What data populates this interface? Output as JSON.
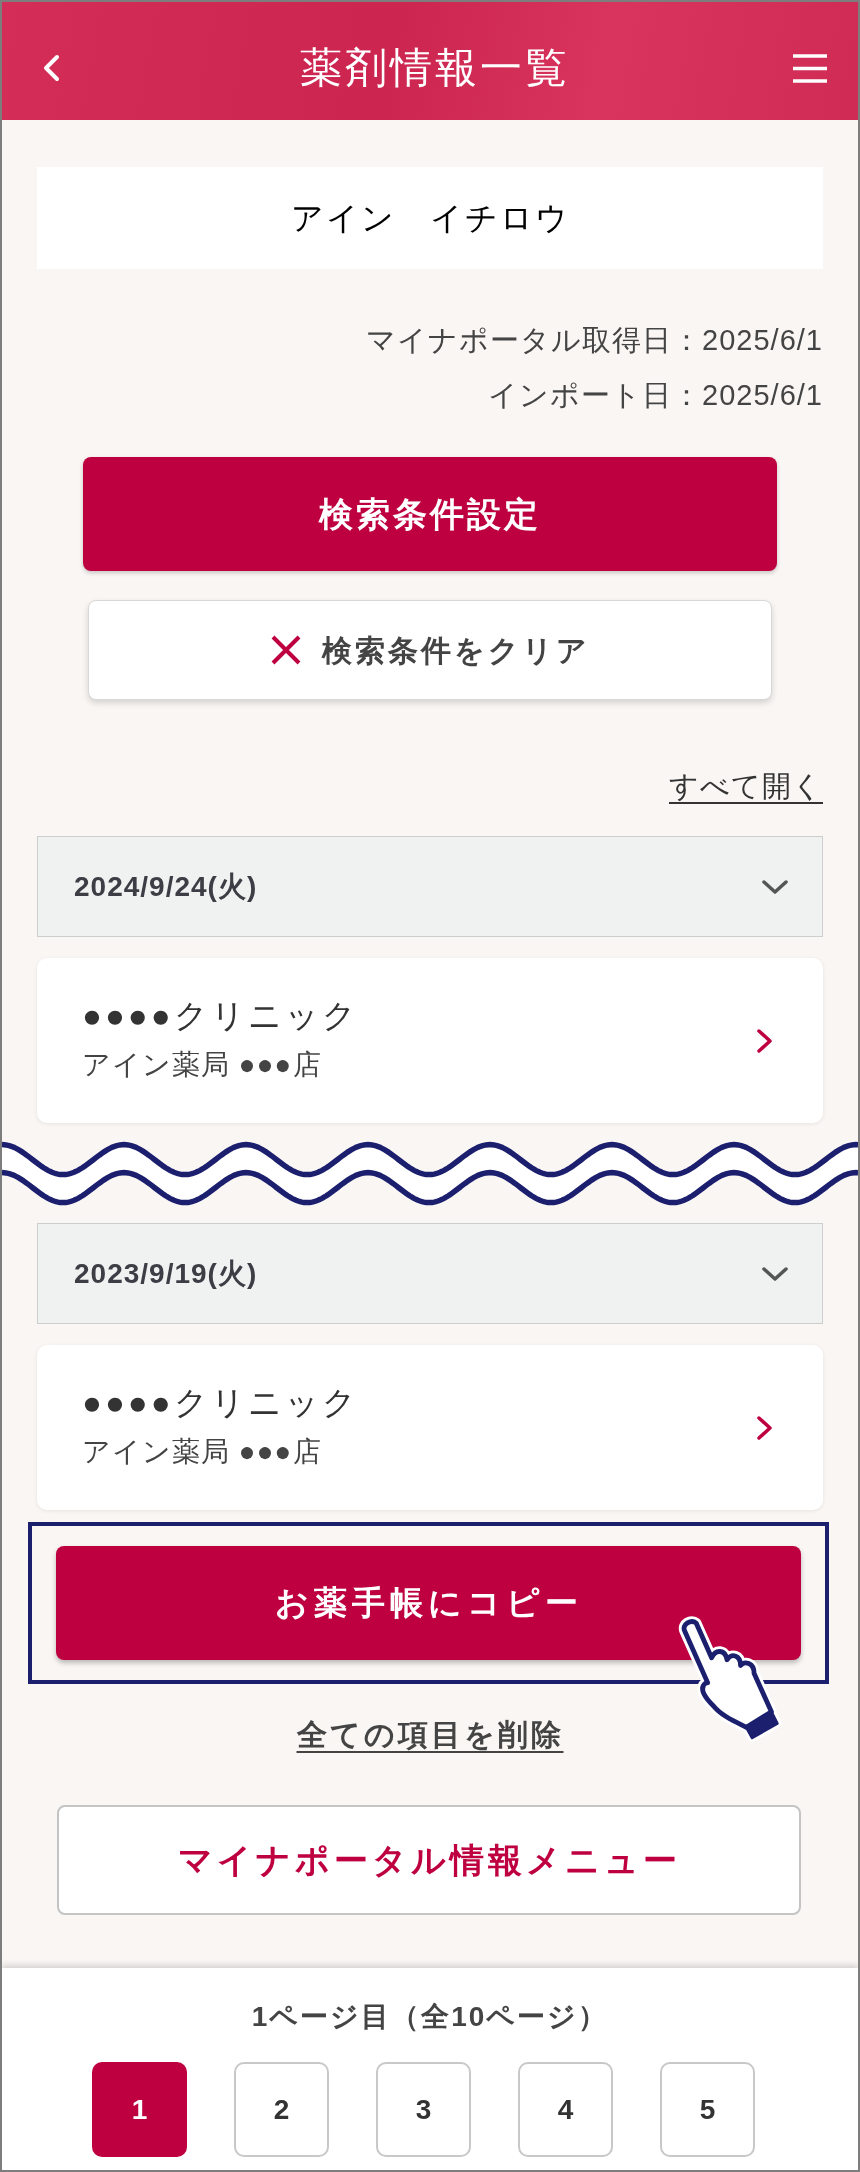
{
  "header": {
    "title": "薬剤情報一覧"
  },
  "patient": {
    "name": "アイン　イチロウ"
  },
  "info_lines": [
    "マイナポータル取得日：2025/6/1",
    "インポート日：2025/6/1"
  ],
  "search_button": {
    "label": "検索条件設定"
  },
  "clear_button": {
    "label": "検索条件をクリア"
  },
  "expand_all_link": {
    "label": "すべて開く"
  },
  "history": [
    {
      "kind": "date_group",
      "date": "2024/9/24(火)",
      "records": [
        {
          "clinic": "●●●●クリニック",
          "pharmacy": "アイン薬局 ●●●店"
        }
      ]
    },
    {
      "kind": "omission_mark"
    },
    {
      "kind": "date_group",
      "date": "2023/9/19(火)",
      "records": [
        {
          "clinic": "●●●●クリニック",
          "pharmacy": "アイン薬局 ●●●店"
        }
      ]
    }
  ],
  "copy_button": {
    "label": "お薬手帳にコピー",
    "highlighted": true
  },
  "delete_all_link": {
    "label": "全ての項目を削除"
  },
  "menu_button": {
    "label": "マイナポータル情報メニュー"
  },
  "pagination": {
    "summary": "1ページ目（全10ページ）",
    "pages": [
      {
        "label": "1",
        "selected": true
      },
      {
        "label": "2",
        "selected": false
      },
      {
        "label": "3",
        "selected": false
      },
      {
        "label": "4",
        "selected": false
      },
      {
        "label": "5",
        "selected": false
      }
    ]
  }
}
